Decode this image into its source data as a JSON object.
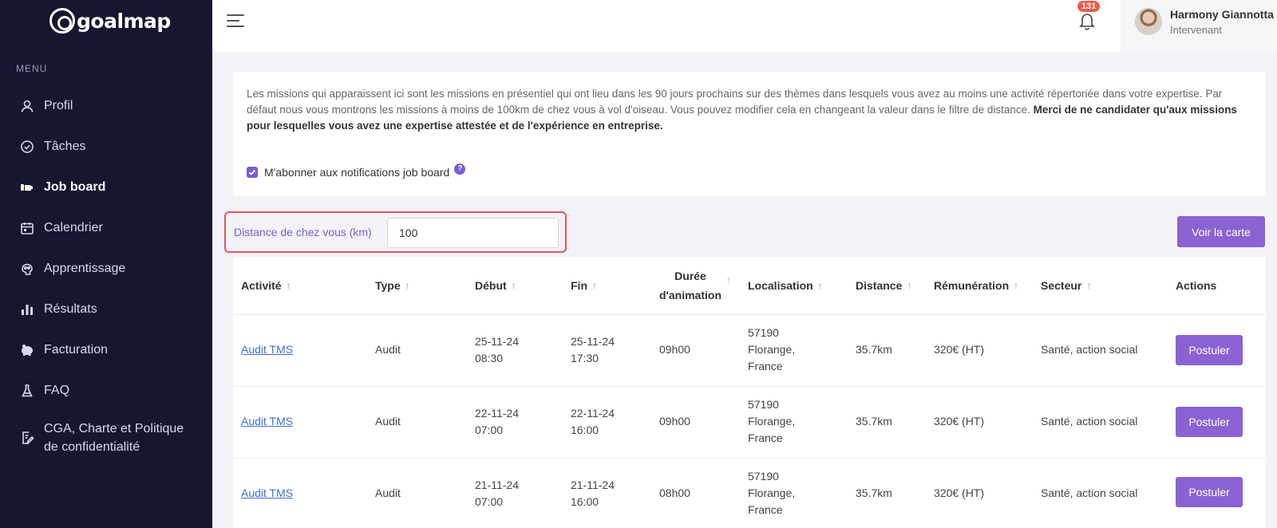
{
  "brand": {
    "name": "goalmap"
  },
  "sidebar": {
    "menu_title": "MENU",
    "items": [
      {
        "label": "Profil",
        "icon": "user-icon"
      },
      {
        "label": "Tâches",
        "icon": "check-circle-icon"
      },
      {
        "label": "Job board",
        "icon": "briefcase-icon",
        "active": true
      },
      {
        "label": "Calendrier",
        "icon": "calendar-icon"
      },
      {
        "label": "Apprentissage",
        "icon": "brain-icon"
      },
      {
        "label": "Résultats",
        "icon": "bar-chart-icon"
      },
      {
        "label": "Facturation",
        "icon": "piggy-bank-icon"
      },
      {
        "label": "FAQ",
        "icon": "flask-icon"
      },
      {
        "label": "CGA, Charte et Politique de confidentialité",
        "icon": "document-edit-icon"
      }
    ]
  },
  "header": {
    "notifications_count": "131",
    "user_name": "Harmony Giannotta",
    "user_role": "Intervenant"
  },
  "info": {
    "text": "Les missions qui apparaissent ici sont les missions en présentiel qui ont lieu dans les 90 jours prochains sur des thèmes dans lesquels vous avez au moins une activité répertoriée dans votre expertise. Par défaut nous vous montrons les missions à moins de 100km de chez vous à vol d'oiseau. Vous pouvez modifier cela en changeant la valeur dans le filtre de distance. ",
    "bold_text": "Merci de ne candidater qu'aux missions pour lesquelles vous avez une expertise attestée et de l'expérience en entreprise.",
    "subscribe_label": "M'abonner aux notifications job board"
  },
  "filter": {
    "label": "Distance de chez vous (km)",
    "value": "100"
  },
  "map_button": "Voir la carte",
  "table": {
    "headers": {
      "activite": "Activité",
      "type": "Type",
      "debut": "Début",
      "fin": "Fin",
      "duree_l1": "Durée",
      "duree_l2": "d'animation",
      "localisation": "Localisation",
      "distance": "Distance",
      "remuneration": "Rémunération",
      "secteur": "Secteur",
      "actions": "Actions"
    },
    "rows": [
      {
        "activite": "Audit TMS",
        "type": "Audit",
        "debut_date": "25-11-24",
        "debut_time": "08:30",
        "fin_date": "25-11-24",
        "fin_time": "17:30",
        "duree": "09h00",
        "loc1": "57190",
        "loc2": "Florange,",
        "loc3": "France",
        "distance": "35.7km",
        "remuneration": "320€ (HT)",
        "secteur": "Santé, action social",
        "action": "Postuler"
      },
      {
        "activite": "Audit TMS",
        "type": "Audit",
        "debut_date": "22-11-24",
        "debut_time": "07:00",
        "fin_date": "22-11-24",
        "fin_time": "16:00",
        "duree": "09h00",
        "loc1": "57190",
        "loc2": "Florange,",
        "loc3": "France",
        "distance": "35.7km",
        "remuneration": "320€ (HT)",
        "secteur": "Santé, action social",
        "action": "Postuler"
      },
      {
        "activite": "Audit TMS",
        "type": "Audit",
        "debut_date": "21-11-24",
        "debut_time": "07:00",
        "fin_date": "21-11-24",
        "fin_time": "16:00",
        "duree": "08h00",
        "loc1": "57190",
        "loc2": "Florange,",
        "loc3": "France",
        "distance": "35.7km",
        "remuneration": "320€ (HT)",
        "secteur": "Santé, action social",
        "action": "Postuler"
      }
    ]
  },
  "colors": {
    "sidebar_bg": "#171631",
    "accent": "#8a63d2",
    "badge": "#f05a4a",
    "highlight_border": "#e8535a",
    "link": "#3b6fd9"
  }
}
